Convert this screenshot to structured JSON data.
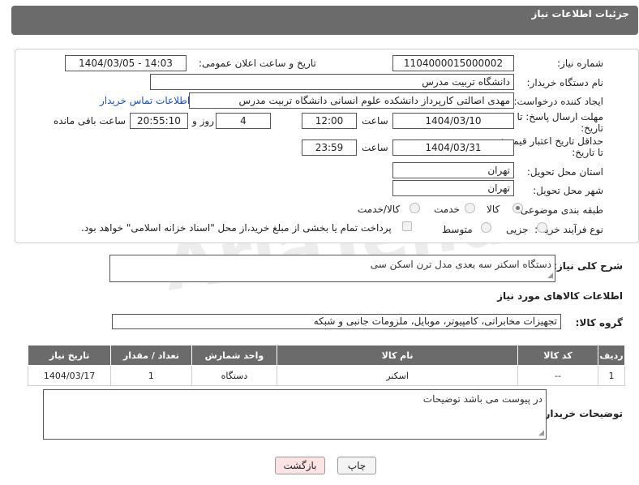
{
  "header": {
    "title": "جزئیات اطلاعات نیاز"
  },
  "watermark": "AriaTender.net",
  "fields": {
    "need_number_label": "شماره نیاز:",
    "need_number": "1104000015000002",
    "announce_label": "تاریخ و ساعت اعلان عمومی:",
    "announce_value": "1404/03/05 - 14:03",
    "buyer_org_label": "نام دستگاه خریدار:",
    "buyer_org": "دانشگاه تربیت مدرس",
    "creator_label": "ایجاد کننده درخواست:",
    "creator": "مهدی اصالتی کارپرداز دانشکده علوم انسانی دانشگاه تربیت مدرس",
    "contact_link": "اطلاعات تماس خریدار",
    "deadline_label_1": "مهلت ارسال پاسخ: تا",
    "deadline_label_2": "تاریخ:",
    "deadline_date": "1404/03/10",
    "time_label": "ساعت",
    "deadline_time": "12:00",
    "days": "4",
    "days_label": "روز و",
    "remaining": "20:55:10",
    "remaining_label": "ساعت باقی مانده",
    "price_valid_label_1": "حداقل تاریخ اعتبار قیمت:",
    "price_valid_label_2": "تا تاریخ:",
    "price_valid_date": "1404/03/31",
    "price_valid_time": "23:59",
    "province_label": "استان محل تحویل:",
    "province": "تهران",
    "city_label": "شهر محل تحویل:",
    "city": "تهران",
    "category_label": "طبقه بندی موضوعی:",
    "category_options": [
      "کالا",
      "خدمت",
      "کالا/خدمت"
    ],
    "process_label": "نوع فرآیند خرید :",
    "process_options": [
      "جزیی",
      "متوسط"
    ],
    "payment_note": "پرداخت تمام یا بخشی از مبلغ خرید،از محل \"اسناد خزانه اسلامی\" خواهد بود."
  },
  "description": {
    "label": "شرح کلی نیاز:",
    "value": "دستگاه اسکنر سه بعدی مدل ترن اسکن سی"
  },
  "goods_section": {
    "title": "اطلاعات کالاهای مورد نیاز",
    "group_label": "گروه کالا:",
    "group_value": "تجهیزات مخابراتی، کامپیوتر، موبایل، ملزومات جانبی و شبکه"
  },
  "table": {
    "headers": [
      "ردیف",
      "کد کالا",
      "نام کالا",
      "واحد شمارش",
      "تعداد / مقدار",
      "تاریخ نیاز"
    ],
    "rows": [
      [
        "1",
        "--",
        "اسکنر",
        "دستگاه",
        "1",
        "1404/03/17"
      ]
    ]
  },
  "buyer_notes": {
    "label": "توضیحات خریدار:",
    "value": "در پیوست می باشد توضیحات"
  },
  "buttons": {
    "print": "چاپ",
    "back": "بازگشت"
  }
}
